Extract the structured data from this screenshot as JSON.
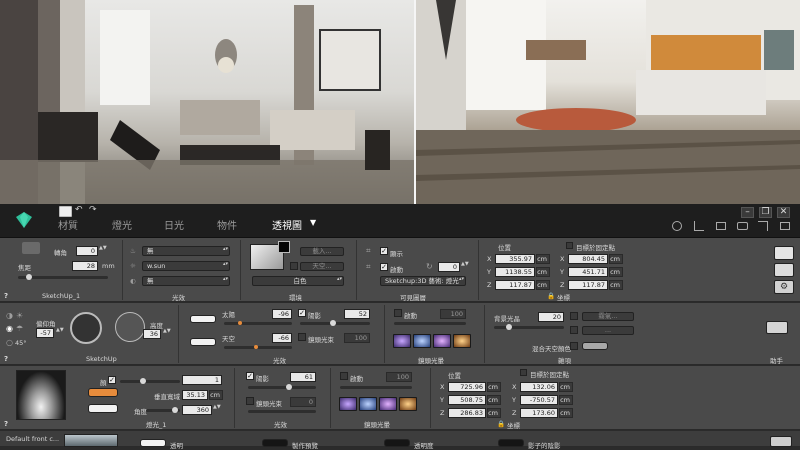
{
  "toolbar": {
    "tabs": [
      "材質",
      "燈光",
      "日光",
      "物件",
      "透視圖"
    ],
    "active_tab": "透視圖",
    "dropdown_arrow": "▼"
  },
  "camera": {
    "rotation_label": "轉角",
    "rotation_value": "0",
    "focal_label": "焦距",
    "focal_value": "28",
    "focal_unit": "mm",
    "name": "SketchUp_1",
    "light_dd1": "無",
    "light_dd2": "w.sun",
    "light_dd3": "無",
    "light_section": "光效",
    "env_btn1": "載入...",
    "env_btn2": "天空...",
    "env_dd": "白色",
    "env_section": "環境",
    "show_label": "顯示",
    "enable_label": "啟動",
    "visible_value": "0",
    "visible_dd": "Sketchup:3D 藝術: 燈光",
    "visible_section": "可見圖層",
    "pos_label": "位置",
    "pos_x": "355.97",
    "pos_y": "1138.55",
    "pos_z": "117.87",
    "unit": "cm",
    "target_label": "目標於固定點",
    "tgt_x": "804.45",
    "tgt_y": "451.71",
    "tgt_z": "117.87",
    "lock_label": "坐標"
  },
  "sun": {
    "azimuth_label": "偏仰角",
    "azimuth_value": "-57",
    "altitude_label": "高度",
    "altitude_value": "36",
    "angle_label": "45°",
    "section": "SketchUp",
    "sun_label": "太陽",
    "sun_value": "-96",
    "sky_label": "天空",
    "sky_value": "-66",
    "lumen_label": "陽影",
    "lumen_value": "52",
    "ambient_label": "鏡頭光束",
    "ambient_value": "100",
    "light_section": "光效",
    "enable_label": "啟動",
    "enable_value": "100",
    "hdri_section": "鏡頭光暈",
    "haze_label": "背景光晶",
    "haze_value": "20",
    "haze_btn1": "霧氣...",
    "haze_btn2": "...",
    "mix_label": "混合天空顏色",
    "misc_section": "雜項",
    "help": "助手"
  },
  "light": {
    "name_label": "顏",
    "intensity_value": "1",
    "vertical_label": "垂直寬域",
    "vertical_value": "35.13",
    "vertical_unit": "cm",
    "angle_label": "角度",
    "angle_value": "360",
    "name": "燈光_1",
    "shadow_label": "陽影",
    "shadow_value": "61",
    "beam_label": "鏡頭光束",
    "beam_value": "0",
    "light_section": "光效",
    "enable_label": "啟動",
    "enable_value": "100",
    "hdri_section": "鏡頭光暈",
    "pos_label": "位置",
    "pos_x": "725.96",
    "pos_y": "508.75",
    "pos_z": "286.83",
    "unit": "cm",
    "target_label": "目標於固定點",
    "tgt_x": "132.06",
    "tgt_y": "-750.57",
    "tgt_z": "173.60",
    "lock_label": "坐標"
  },
  "bottom": {
    "name": "Default front c...",
    "item1": "透明",
    "item2": "製作預覽",
    "item3": "透明度",
    "item4": "影子的陰影"
  },
  "colors": {
    "accent_orange": "#e78c3c",
    "panel_bg": "#4a4a4a",
    "toolbar_bg": "#1e1e1e",
    "field_bg": "#e9e9e9"
  }
}
